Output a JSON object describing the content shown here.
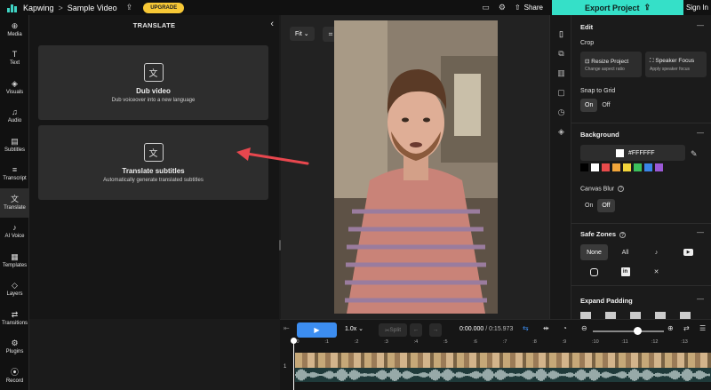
{
  "topbar": {
    "brand": "Kapwing",
    "separator": ">",
    "project_name": "Sample Video",
    "upgrade_label": "UPGRADE",
    "share_label": "Share",
    "export_label": "Export Project",
    "signin_label": "Sign In"
  },
  "rail": {
    "items": [
      {
        "label": "Media",
        "icon": "plus-circle-icon",
        "glyph": "⊕"
      },
      {
        "label": "Text",
        "icon": "text-icon",
        "glyph": "T"
      },
      {
        "label": "Visuals",
        "icon": "shapes-icon",
        "glyph": "◈"
      },
      {
        "label": "Audio",
        "icon": "music-icon",
        "glyph": "♫"
      },
      {
        "label": "Subtitles",
        "icon": "subtitles-icon",
        "glyph": "▤"
      },
      {
        "label": "Transcript",
        "icon": "transcript-icon",
        "glyph": "≡"
      },
      {
        "label": "Translate",
        "icon": "translate-icon",
        "glyph": "文"
      },
      {
        "label": "AI Voice",
        "icon": "voice-icon",
        "glyph": "♪"
      },
      {
        "label": "Templates",
        "icon": "templates-icon",
        "glyph": "▦"
      },
      {
        "label": "Layers",
        "icon": "layers-icon",
        "glyph": "◇"
      },
      {
        "label": "Transitions",
        "icon": "transitions-icon",
        "glyph": "⇄"
      },
      {
        "label": "Plugins",
        "icon": "plugins-icon",
        "glyph": "⚙"
      },
      {
        "label": "Record",
        "icon": "record-icon",
        "glyph": "⦿"
      }
    ],
    "active_index": 6
  },
  "panel": {
    "title": "TRANSLATE",
    "cards": [
      {
        "title": "Dub video",
        "subtitle": "Dub voiceover into a new language",
        "icon": "dub-icon"
      },
      {
        "title": "Translate subtitles",
        "subtitle": "Automatically generate translated subtitles",
        "icon": "translate-subtitles-icon"
      }
    ]
  },
  "canvas": {
    "fit_label": "Fit"
  },
  "props": {
    "edit_header": "Edit",
    "crop_label": "Crop",
    "resize_title": "Resize Project",
    "resize_sub": "Change aspect ratio",
    "speaker_title": "Speaker Focus",
    "speaker_sub": "Apply speaker focus",
    "snap_label": "Snap to Grid",
    "on_label": "On",
    "off_label": "Off",
    "snap_state": "On",
    "background_header": "Background",
    "background_hex": "#FFFFFF",
    "swatches": [
      "#000000",
      "#ffffff",
      "#e84b4b",
      "#f0a53a",
      "#f2d43b",
      "#3cbf5c",
      "#3a86e8",
      "#9b59d6"
    ],
    "canvas_blur_label": "Canvas Blur",
    "blur_state": "Off",
    "safe_zones_header": "Safe Zones",
    "safe_none": "None",
    "safe_all": "All",
    "safe_selected": "None",
    "safe_platforms": [
      "tiktok-icon",
      "youtube-icon",
      "instagram-icon",
      "linkedin-icon",
      "x-icon"
    ],
    "expand_header": "Expand Padding"
  },
  "timeline": {
    "speed": "1.0x",
    "split_label": "Split",
    "timecode_current": "0:00.000",
    "timecode_total": "/ 0:15.973",
    "ticks": [
      ":0",
      ":1",
      ":2",
      ":3",
      ":4",
      ":5",
      ":6",
      ":7",
      ":8",
      ":9",
      ":10",
      ":11",
      ":12",
      ":13",
      ":14"
    ],
    "track_number": "1"
  }
}
